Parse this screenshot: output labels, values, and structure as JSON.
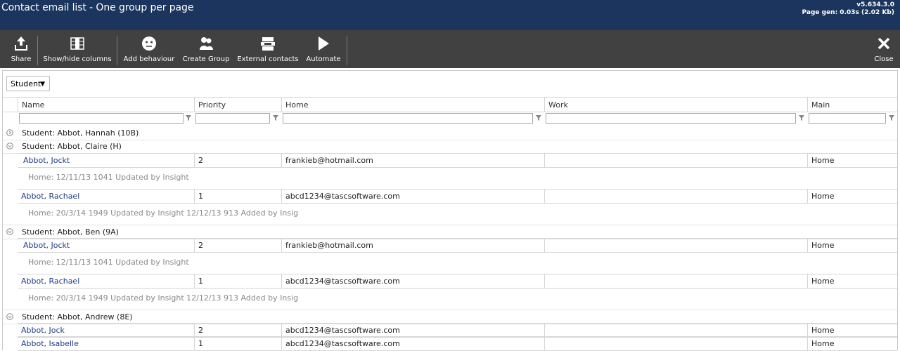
{
  "header": {
    "title": "Contact email list - One group per page",
    "version": "v5.634.3.0",
    "page_gen": "Page gen: 0.03s (2.02 Kb)"
  },
  "toolbar": {
    "share": "Share",
    "show_hide": "Show/hide columns",
    "add_behaviour": "Add behaviour",
    "create_group": "Create Group",
    "external_contacts": "External contacts",
    "automate": "Automate",
    "close": "Close"
  },
  "dropdown": {
    "value": "Student"
  },
  "columns": [
    "Name",
    "Priority",
    "Home",
    "Work",
    "Main"
  ],
  "groups": [
    {
      "title": "Student: Abbot, Hannah (10B)",
      "expanded": false,
      "rows": []
    },
    {
      "title": "Student: Abbot, Claire (H)",
      "expanded": true,
      "rows": [
        {
          "name": "Abbot, Jockt",
          "priority": "2",
          "home": "frankieb@hotmail.com",
          "work": "",
          "main": "Home",
          "note": "Home: 12/11/13 1041 Updated by Insight"
        },
        {
          "name": "Abbot, Rachael",
          "priority": "1",
          "home": "abcd1234@tascsoftware.com",
          "work": "",
          "main": "Home",
          "note": "Home: 20/3/14 1949 Updated by Insight 12/12/13 913 Added by Insig"
        }
      ]
    },
    {
      "title": "Student: Abbot, Ben (9A)",
      "expanded": true,
      "rows": [
        {
          "name": "Abbot, Jockt",
          "priority": "2",
          "home": "frankieb@hotmail.com",
          "work": "",
          "main": "Home",
          "note": "Home: 12/11/13 1041 Updated by Insight"
        },
        {
          "name": "Abbot, Rachael",
          "priority": "1",
          "home": "abcd1234@tascsoftware.com",
          "work": "",
          "main": "Home",
          "note": "Home: 20/3/14 1949 Updated by Insight 12/12/13 913 Added by Insig"
        }
      ]
    },
    {
      "title": "Student: Abbot, Andrew (8E)",
      "expanded": true,
      "rows": [
        {
          "name": "Abbot, Jock",
          "priority": "2",
          "home": "abcd1234@tascsoftware.com",
          "work": "",
          "main": "Home",
          "note": ""
        },
        {
          "name": "Abbot, Isabelle",
          "priority": "1",
          "home": "abcd1234@tascsoftware.com",
          "work": "",
          "main": "Home",
          "note": ""
        }
      ]
    }
  ]
}
